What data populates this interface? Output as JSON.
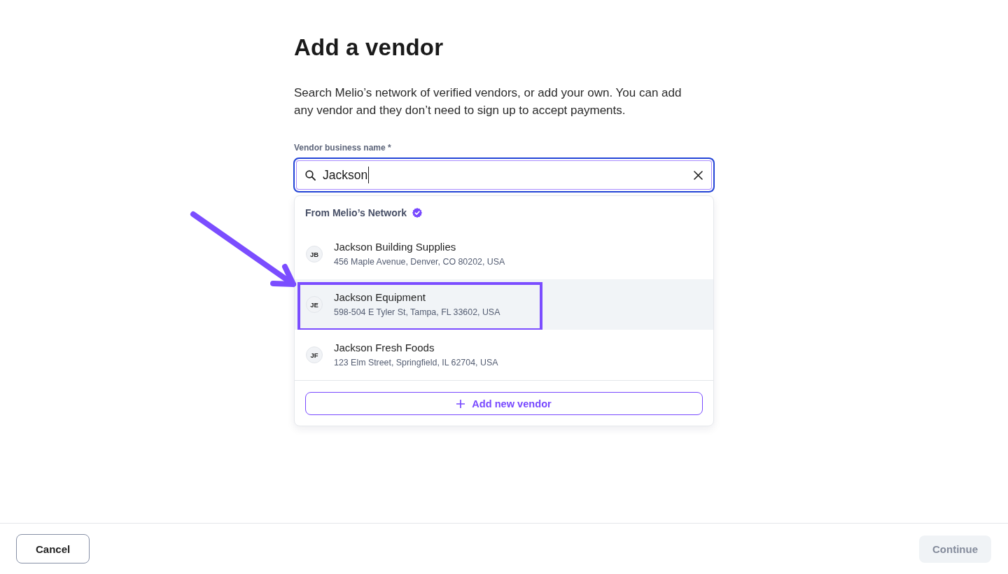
{
  "page": {
    "title": "Add a vendor",
    "description": "Search Melio’s network of verified vendors, or add your own. You can add any vendor and they don’t need to sign up to accept payments."
  },
  "vendor_field": {
    "label": "Vendor business name *",
    "value": "Jackson",
    "focused": true
  },
  "dropdown": {
    "heading": "From Melio’s Network",
    "verified": true,
    "vendors": [
      {
        "initials": "JB",
        "name": "Jackson Building Supplies",
        "address": "456 Maple Avenue, Denver, CO 80202, USA",
        "selected": false,
        "annotated": false
      },
      {
        "initials": "JE",
        "name": "Jackson Equipment",
        "address": "598-504 E Tyler St, Tampa, FL 33602, USA",
        "selected": true,
        "annotated": true
      },
      {
        "initials": "JF",
        "name": "Jackson Fresh Foods",
        "address": "123 Elm Street, Springfield, IL 62704, USA",
        "selected": false,
        "annotated": false
      }
    ],
    "add_button": {
      "label": "Add new vendor"
    }
  },
  "footer": {
    "buttons": [
      {
        "label": "Cancel",
        "kind": "outline",
        "disabled": false
      },
      {
        "label": "Continue",
        "kind": "solid",
        "disabled": true
      }
    ]
  }
}
